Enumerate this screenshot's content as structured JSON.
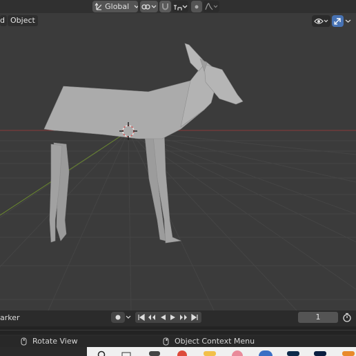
{
  "header": {
    "transform_orientation": "Global",
    "orientation_icon": "transform-axes-icon",
    "pivot_icon": "link-pivot-icon",
    "snap_icon": "snap-magnet-icon",
    "snap_increment_icon": "snap-increment-icon",
    "proportional_icon": "proportional-edit-icon",
    "falloff_icon": "falloff-curve-icon",
    "visibility_icon": "eye-visibility-icon",
    "gizmo_icon": "gizmo-arrow-icon"
  },
  "menus": {
    "partial_menu": "d",
    "object_menu": "Object"
  },
  "timeline": {
    "marker_menu": "arker",
    "current_frame": "1",
    "keyframe_icon": "record-dot-icon",
    "controls": [
      "jump-start-icon",
      "prev-keyframe-icon",
      "play-reverse-icon",
      "play-icon",
      "next-keyframe-icon",
      "jump-end-icon"
    ]
  },
  "statusbar": {
    "left_hint": "Rotate View",
    "right_hint": "Object Context Menu"
  },
  "colors": {
    "viewport_bg": "#3b3b3b",
    "x_axis": "#8a3a3a",
    "y_axis": "#6b8a2e",
    "active_button": "#4772b3",
    "model": "#a7a7a7"
  },
  "taskbar_apps": [
    "search-icon",
    "taskview-icon",
    "store-icon",
    "chrome-icon",
    "files-icon",
    "media-icon",
    "blender-icon",
    "photoshop-icon",
    "lightroom-icon",
    "other-app-icon"
  ]
}
